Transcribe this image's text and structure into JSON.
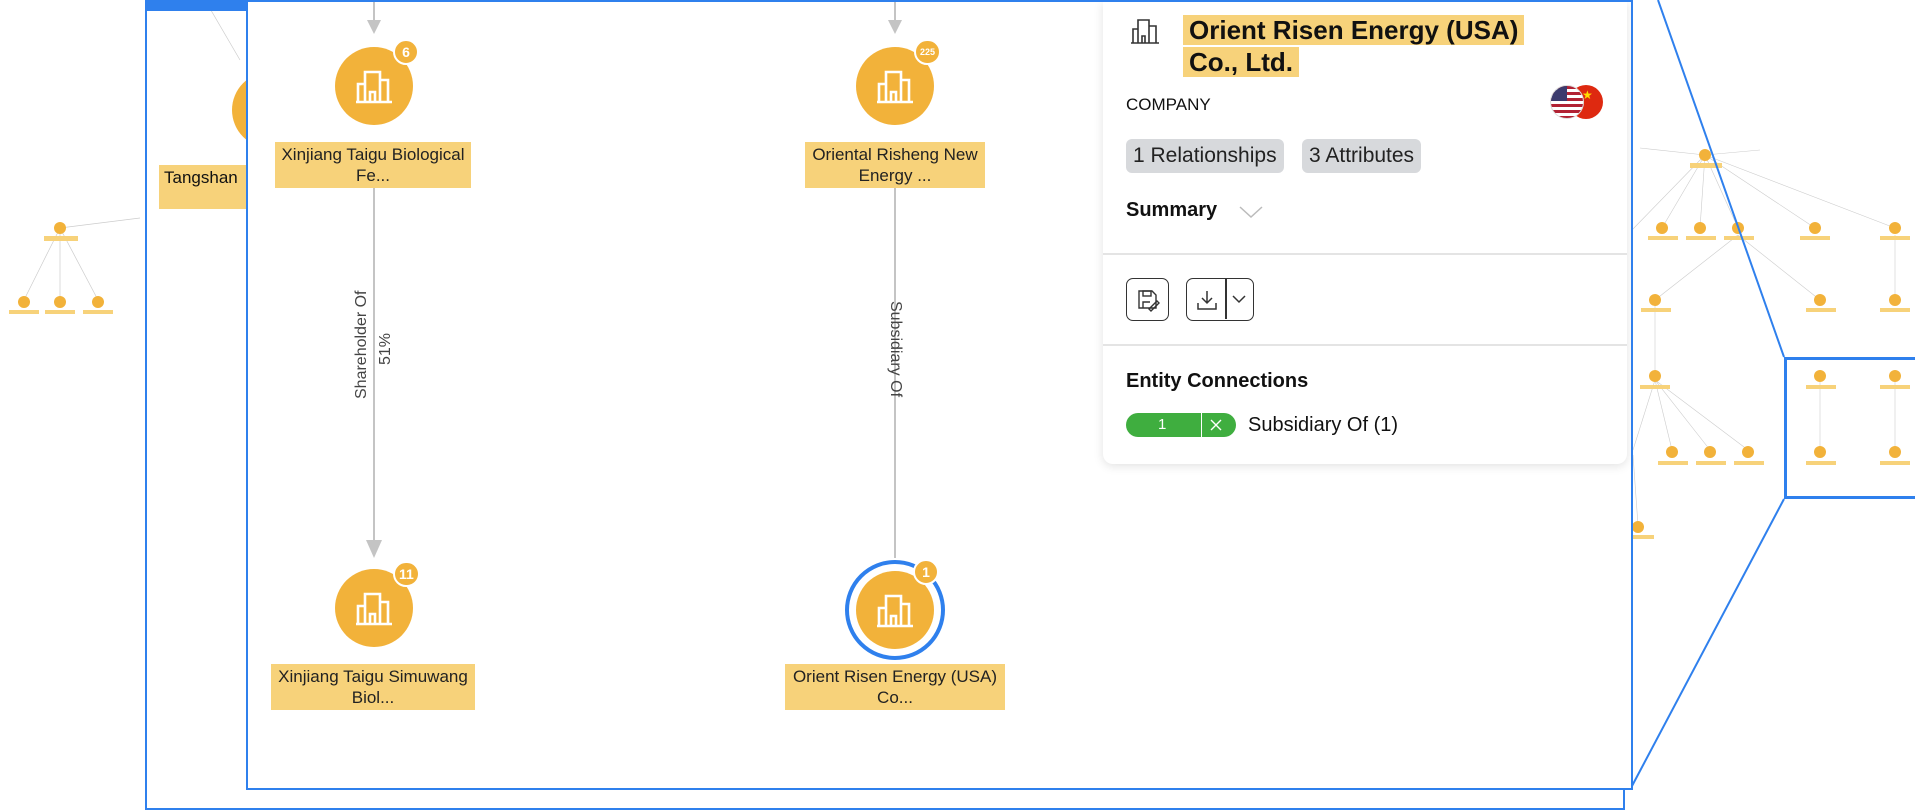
{
  "background_graph": {
    "left_label": "Tangshan"
  },
  "graph": {
    "nodes": [
      {
        "label": "Xinjiang Taigu Biological Fe...",
        "badge": "6"
      },
      {
        "label": "Oriental Risheng New Energy ...",
        "badge": "225"
      },
      {
        "label": "Xinjiang Taigu Simuwang Biol...",
        "badge": "11"
      },
      {
        "label": "Orient Risen Energy (USA) Co...",
        "badge": "1"
      }
    ],
    "edges": [
      {
        "label": "Shareholder Of",
        "sublabel": "51%"
      },
      {
        "label": "Subsidiary Of"
      }
    ]
  },
  "detail": {
    "entity_icon": "company-building-icon",
    "title": "Orient Risen Energy (USA) Co., Ltd.",
    "type": "COMPANY",
    "flags": [
      "us-flag-icon",
      "china-flag-icon"
    ],
    "relationships_label": "1 Relationships",
    "attributes_label": "3 Attributes",
    "summary_label": "Summary",
    "connections_heading": "Entity Connections",
    "connection": {
      "count": "1",
      "label": "Subsidiary Of (1)"
    }
  },
  "colors": {
    "accent": "#2f80ed",
    "node": "#f2b23a",
    "label_bg": "#f7d27a",
    "connection": "#3fae3f"
  }
}
